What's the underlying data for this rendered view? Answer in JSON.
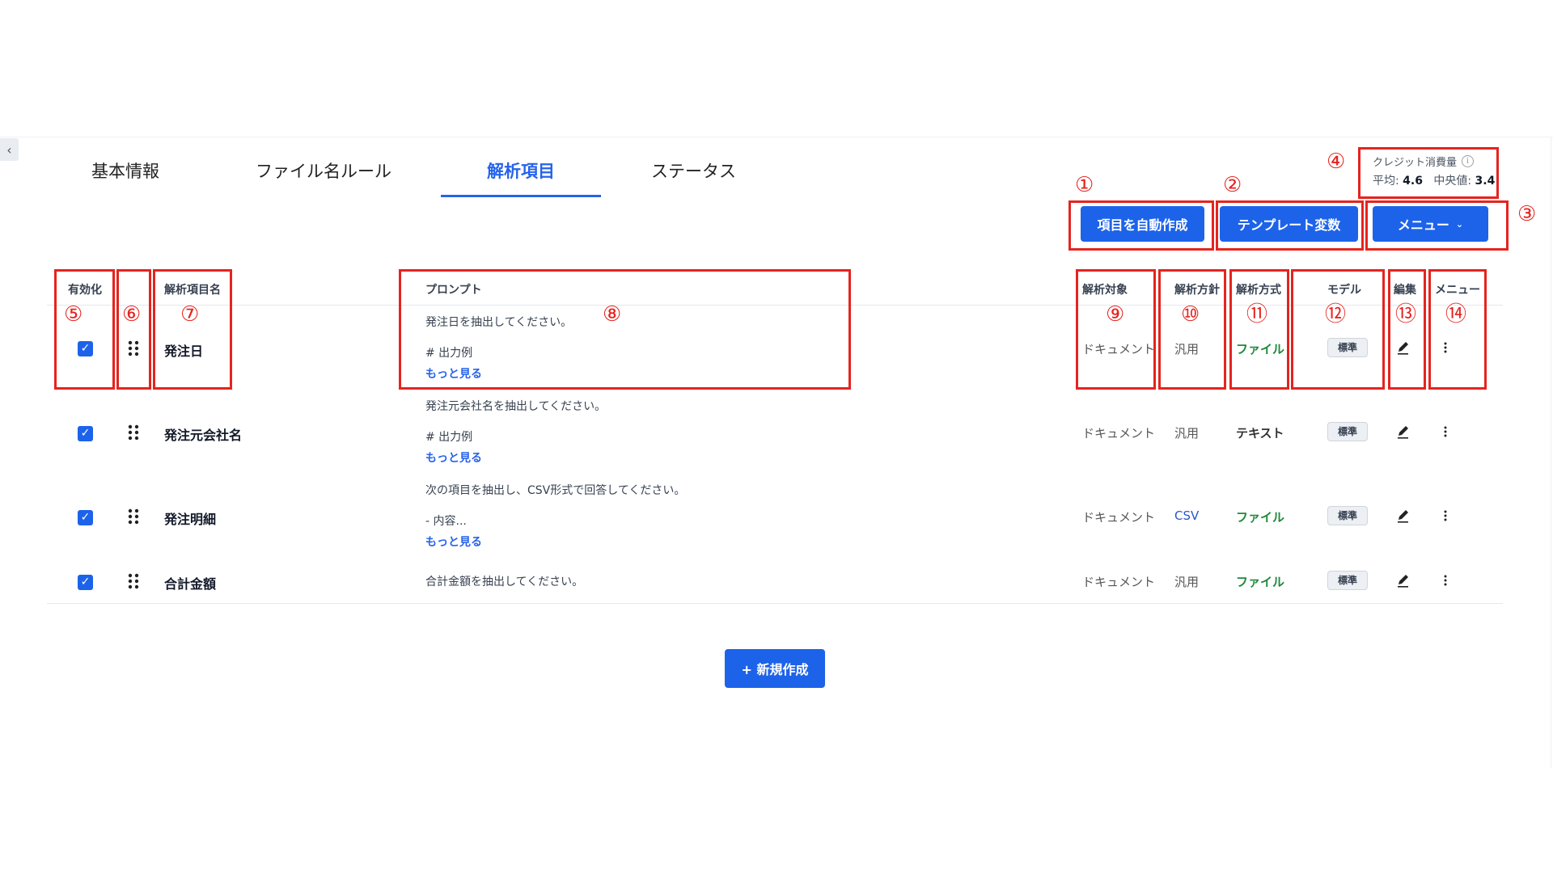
{
  "tabs": [
    {
      "label": "基本情報"
    },
    {
      "label": "ファイル名ルール"
    },
    {
      "label": "解析項目",
      "active": true
    },
    {
      "label": "ステータス"
    }
  ],
  "toolbar": {
    "auto_create": "項目を自動作成",
    "template_vars": "テンプレート変数",
    "menu": "メニュー"
  },
  "credit": {
    "title": "クレジット消費量",
    "avg_label": "平均:",
    "avg_value": "4.6",
    "median_label": "中央値:",
    "median_value": "3.4"
  },
  "columns": {
    "enabled": "有効化",
    "name": "解析項目名",
    "prompt": "プロンプト",
    "target": "解析対象",
    "policy": "解析方針",
    "method": "解析方式",
    "model": "モデル",
    "edit": "編集",
    "menu": "メニュー"
  },
  "rows": [
    {
      "name": "発注日",
      "prompt_line1": "発注日を抽出してください。",
      "prompt_line2": "# 出力例",
      "more": "もっと見る",
      "target": "ドキュメント",
      "policy": "汎用",
      "method": "ファイル",
      "model": "標準"
    },
    {
      "name": "発注元会社名",
      "prompt_line1": "発注元会社名を抽出してください。",
      "prompt_line2": "# 出力例",
      "more": "もっと見る",
      "target": "ドキュメント",
      "policy": "汎用",
      "method": "テキスト",
      "model": "標準"
    },
    {
      "name": "発注明細",
      "prompt_line1": "次の項目を抽出し、CSV形式で回答してください。",
      "prompt_line2": "- 内容...",
      "more": "もっと見る",
      "target": "ドキュメント",
      "policy": "CSV",
      "method": "ファイル",
      "model": "標準"
    },
    {
      "name": "合計金額",
      "prompt_line1": "合計金額を抽出してください。",
      "target": "ドキュメント",
      "policy": "汎用",
      "method": "ファイル",
      "model": "標準"
    }
  ],
  "new_button": "+ 新規作成",
  "annotations": [
    "①",
    "②",
    "③",
    "④",
    "⑤",
    "⑥",
    "⑦",
    "⑧",
    "⑨",
    "⑩",
    "⑪",
    "⑫",
    "⑬",
    "⑭"
  ],
  "colors": {
    "accent": "#1d63ea",
    "annotation": "#e5241f",
    "file_green": "#1e8a3a"
  }
}
